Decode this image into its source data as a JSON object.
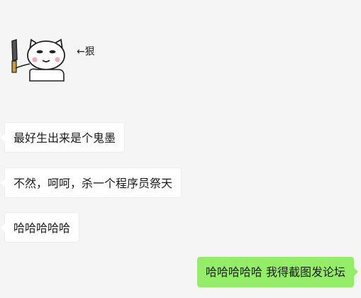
{
  "chat": {
    "sticker": {
      "icon": "cat-with-knife-sticker",
      "caption": "←狠"
    },
    "messages": [
      {
        "side": "incoming",
        "text": "最好生出来是个鬼墨"
      },
      {
        "side": "incoming",
        "text": "不然，呵呵，杀一个程序员祭天"
      },
      {
        "side": "incoming",
        "text": "哈哈哈哈哈"
      },
      {
        "side": "outgoing",
        "text": "哈哈哈哈哈 我得截图发论坛"
      }
    ]
  },
  "colors": {
    "background": "#f5f5f5",
    "incoming_bubble": "#ffffff",
    "outgoing_bubble": "#95ec69"
  }
}
